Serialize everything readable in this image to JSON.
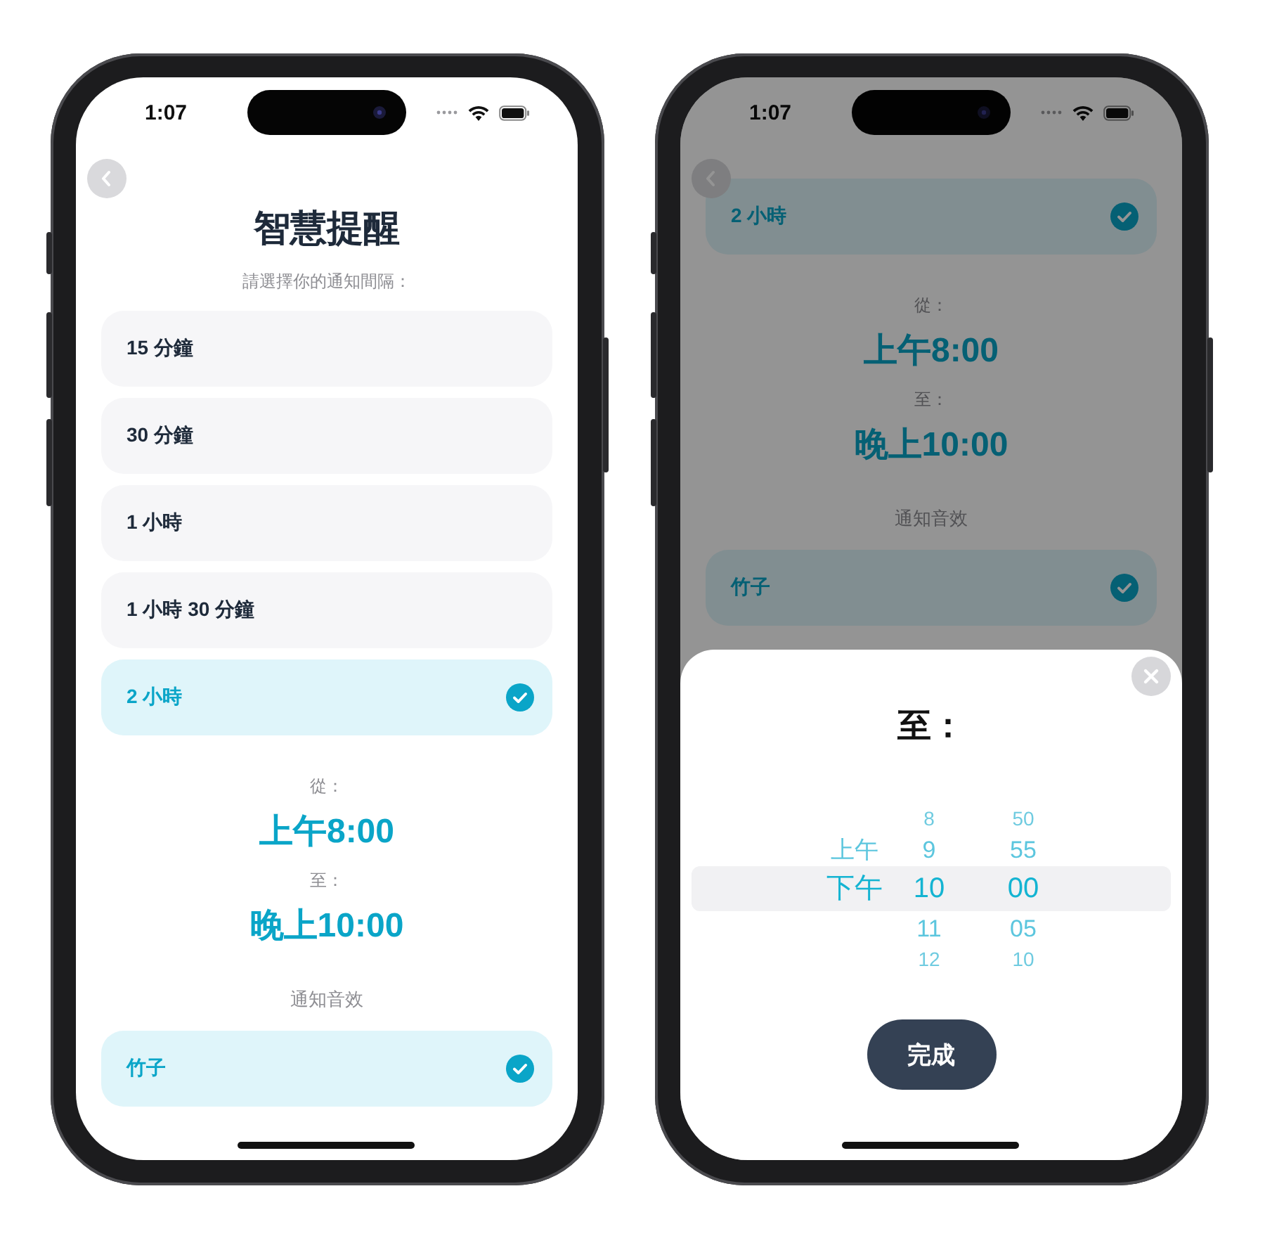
{
  "phones": [
    {
      "status_bar": {
        "time": "1:07"
      },
      "dimmed": false,
      "screen": {
        "title": "智慧提醒",
        "subtitle": "請選擇你的通知間隔：",
        "intervals": [
          {
            "label": "15 分鐘",
            "selected": false
          },
          {
            "label": "30 分鐘",
            "selected": false
          },
          {
            "label": "1 小時",
            "selected": false
          },
          {
            "label": "1 小時 30 分鐘",
            "selected": false
          },
          {
            "label": "2 小時",
            "selected": true
          }
        ],
        "from_label": "從：",
        "from_time": "上午8:00",
        "to_label": "至：",
        "to_time": "晚上10:00",
        "sound_heading": "通知音效",
        "sounds": [
          {
            "label": "竹子",
            "selected": true
          }
        ]
      }
    },
    {
      "status_bar": {
        "time": "1:07"
      },
      "dimmed": true,
      "screen": {
        "intervals": [
          {
            "label": "2 小時",
            "selected": true
          }
        ],
        "from_label": "從：",
        "from_time": "上午8:00",
        "to_label": "至：",
        "to_time": "晚上10:00",
        "sound_heading": "通知音效",
        "sounds": [
          {
            "label": "竹子",
            "selected": true
          }
        ]
      },
      "sheet": {
        "title": "至：",
        "columns": [
          [
            {
              "label": "上午",
              "selected": false
            },
            {
              "label": "下午",
              "selected": true
            }
          ],
          [
            {
              "label": "8",
              "selected": false
            },
            {
              "label": "9",
              "selected": false
            },
            {
              "label": "10",
              "selected": true
            },
            {
              "label": "11",
              "selected": false
            },
            {
              "label": "12",
              "selected": false
            }
          ],
          [
            {
              "label": "50",
              "selected": false
            },
            {
              "label": "55",
              "selected": false
            },
            {
              "label": "00",
              "selected": true
            },
            {
              "label": "05",
              "selected": false
            },
            {
              "label": "10",
              "selected": false
            }
          ]
        ],
        "done_button": "完成"
      }
    }
  ]
}
